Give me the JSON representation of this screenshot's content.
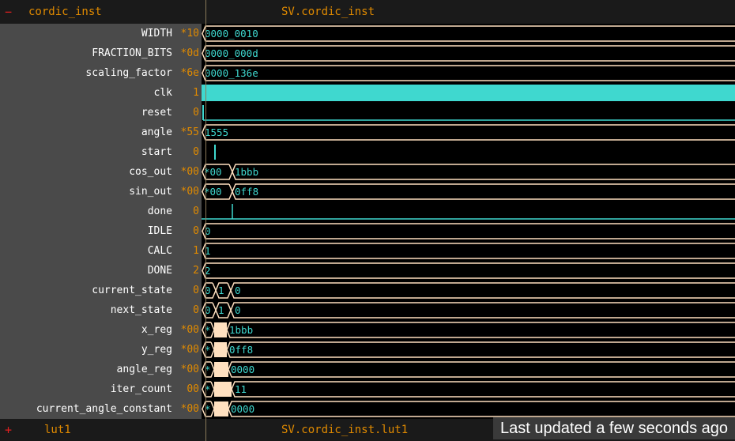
{
  "top_group": {
    "toggle": "−",
    "name": "cordic_inst",
    "path": "SV.cordic_inst"
  },
  "bottom_group": {
    "toggle": "+",
    "name": "lut1",
    "path": "SV.cordic_inst.lut1"
  },
  "toast": "Last updated a few seconds ago",
  "colors": {
    "wave": "#3fd8cf",
    "value": "#e08a00",
    "bus_edge": "#ffe0c0",
    "panel": "#4a4a4a"
  },
  "signals": [
    {
      "name": "WIDTH",
      "value": "*10",
      "wave_text": "0000_0010"
    },
    {
      "name": "FRACTION_BITS",
      "value": "*0d",
      "wave_text": "0000_000d"
    },
    {
      "name": "scaling_factor",
      "value": "*6e",
      "wave_text": "0000_136e"
    },
    {
      "name": "clk",
      "value": "1"
    },
    {
      "name": "reset",
      "value": "0"
    },
    {
      "name": "angle",
      "value": "*55",
      "wave_text": "1555"
    },
    {
      "name": "start",
      "value": "0"
    },
    {
      "name": "cos_out",
      "value": "*00",
      "wave_text_a": "*00",
      "wave_text_b": "1bbb"
    },
    {
      "name": "sin_out",
      "value": "*00",
      "wave_text_a": "*00",
      "wave_text_b": "0ff8"
    },
    {
      "name": "done",
      "value": "0"
    },
    {
      "name": "IDLE",
      "value": "0",
      "wave_text": "0"
    },
    {
      "name": "CALC",
      "value": "1",
      "wave_text": "1"
    },
    {
      "name": "DONE",
      "value": "2",
      "wave_text": "2"
    },
    {
      "name": "current_state",
      "value": "0",
      "wave_text_a": "0",
      "wave_text_b": "1",
      "wave_text_c": "0"
    },
    {
      "name": "next_state",
      "value": "0",
      "wave_text_a": "0",
      "wave_text_b": "1",
      "wave_text_c": "0"
    },
    {
      "name": "x_reg",
      "value": "*00",
      "wave_text_a": "*",
      "wave_text_b": "1bbb"
    },
    {
      "name": "y_reg",
      "value": "*00",
      "wave_text_a": "*",
      "wave_text_b": "0ff8"
    },
    {
      "name": "angle_reg",
      "value": "*00",
      "wave_text_a": "*",
      "wave_text_b": "0000"
    },
    {
      "name": "iter_count",
      "value": "00",
      "wave_text_a": "*",
      "wave_text_b": "11"
    },
    {
      "name": "current_angle_constant",
      "value": "*00",
      "wave_text_a": "*",
      "wave_text_b": "0000"
    }
  ]
}
